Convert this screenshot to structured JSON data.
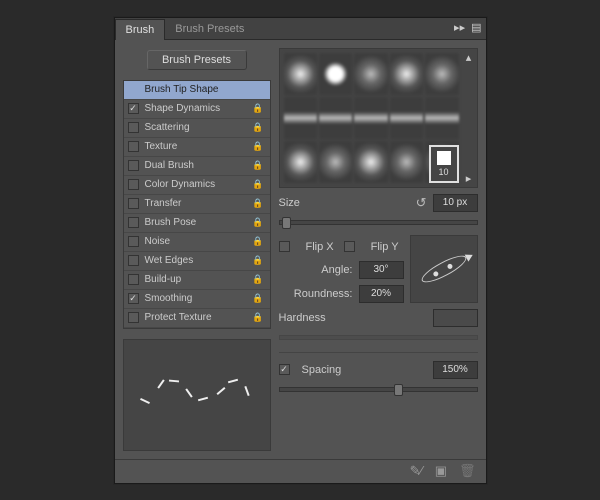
{
  "tabs": {
    "brush": "Brush",
    "presets": "Brush Presets"
  },
  "presetsBtn": "Brush Presets",
  "options": [
    {
      "label": "Brush Tip Shape",
      "checked": null,
      "lock": false,
      "sel": true
    },
    {
      "label": "Shape Dynamics",
      "checked": true,
      "lock": true
    },
    {
      "label": "Scattering",
      "checked": false,
      "lock": true
    },
    {
      "label": "Texture",
      "checked": false,
      "lock": true
    },
    {
      "label": "Dual Brush",
      "checked": false,
      "lock": true
    },
    {
      "label": "Color Dynamics",
      "checked": false,
      "lock": true
    },
    {
      "label": "Transfer",
      "checked": false,
      "lock": true
    },
    {
      "label": "Brush Pose",
      "checked": false,
      "lock": true
    },
    {
      "label": "Noise",
      "checked": false,
      "lock": true
    },
    {
      "label": "Wet Edges",
      "checked": false,
      "lock": true
    },
    {
      "label": "Build-up",
      "checked": false,
      "lock": true
    },
    {
      "label": "Smoothing",
      "checked": true,
      "lock": true
    },
    {
      "label": "Protect Texture",
      "checked": false,
      "lock": true
    }
  ],
  "selectedThumb": "10",
  "size": {
    "label": "Size",
    "value": "10 px"
  },
  "flip": {
    "x": "Flip X",
    "y": "Flip Y"
  },
  "angle": {
    "label": "Angle:",
    "value": "30°"
  },
  "roundness": {
    "label": "Roundness:",
    "value": "20%"
  },
  "hardness": {
    "label": "Hardness"
  },
  "spacing": {
    "label": "Spacing",
    "value": "150%",
    "checked": true
  }
}
